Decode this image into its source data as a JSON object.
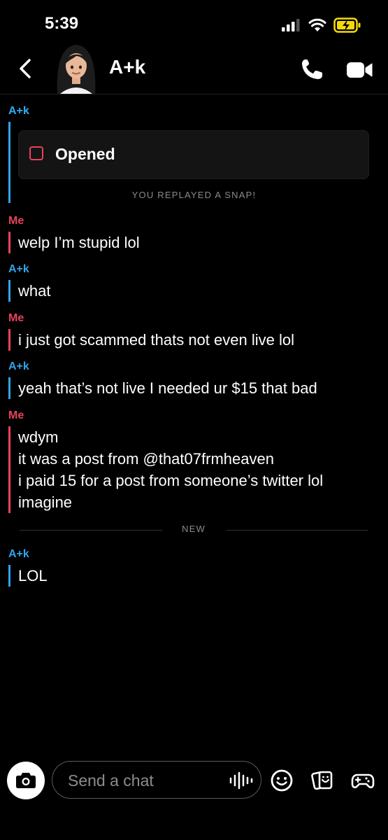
{
  "status_bar": {
    "time": "5:39"
  },
  "header": {
    "title": "A+k"
  },
  "messages": [
    {
      "sender": "A+k",
      "type": "snap",
      "label": "Opened",
      "note": "YOU REPLAYED A SNAP!"
    },
    {
      "sender": "Me",
      "lines": [
        "welp I’m stupid lol"
      ]
    },
    {
      "sender": "A+k",
      "lines": [
        "what"
      ]
    },
    {
      "sender": "Me",
      "lines": [
        "i just got scammed thats not even live lol"
      ]
    },
    {
      "sender": "A+k",
      "lines": [
        "yeah that’s not live I needed ur $15 that bad"
      ]
    },
    {
      "sender": "Me",
      "lines": [
        "wdym",
        "it was a post from @that07frmheaven",
        "i paid 15 for a post from someone’s twitter lol",
        "imagine"
      ]
    },
    {
      "sender": "A+k",
      "lines": [
        "LOL"
      ]
    }
  ],
  "separator": {
    "label": "NEW"
  },
  "composer": {
    "placeholder": "Send a chat"
  },
  "colors": {
    "friend": "#33a3e8",
    "me": "#e9425a",
    "battery": "#f5d90a"
  }
}
